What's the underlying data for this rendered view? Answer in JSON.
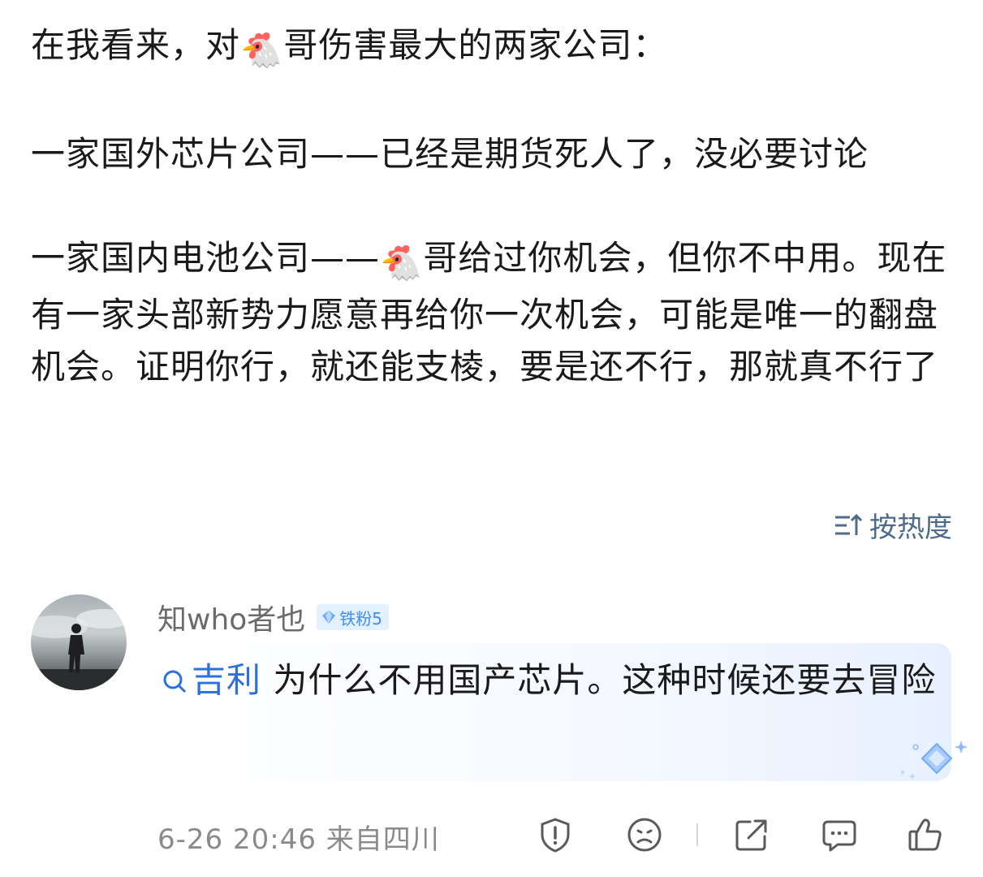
{
  "post": {
    "line1_before": "在我看来，对",
    "line1_after": "哥伤害最大的两家公司：",
    "line2": "一家国外芯片公司——已经是期货死人了，没必要讨论",
    "line3_before": "一家国内电池公司——",
    "line3_after": "哥给过你机会，但你不中用。现在有一家头部新势力愿意再给你一次机会，可能是唯一的翻盘机会。证明你行，就还能支棱，要是还不行，那就真不行了",
    "emoji": "🐔"
  },
  "sort": {
    "label": "按热度",
    "icon": "sort-icon"
  },
  "comment": {
    "username": "知who者也",
    "badge_label": "铁粉5",
    "search_term": "吉利",
    "text": " 为什么不用国产芯片。这种时候还要去冒险",
    "date": "6-26 20:46",
    "location": "来自四川",
    "colors": {
      "link": "#2f6fdb",
      "badge_bg": "#e3f0ff",
      "badge_text": "#3f8cf2",
      "sort": "#4e6b8c"
    }
  }
}
